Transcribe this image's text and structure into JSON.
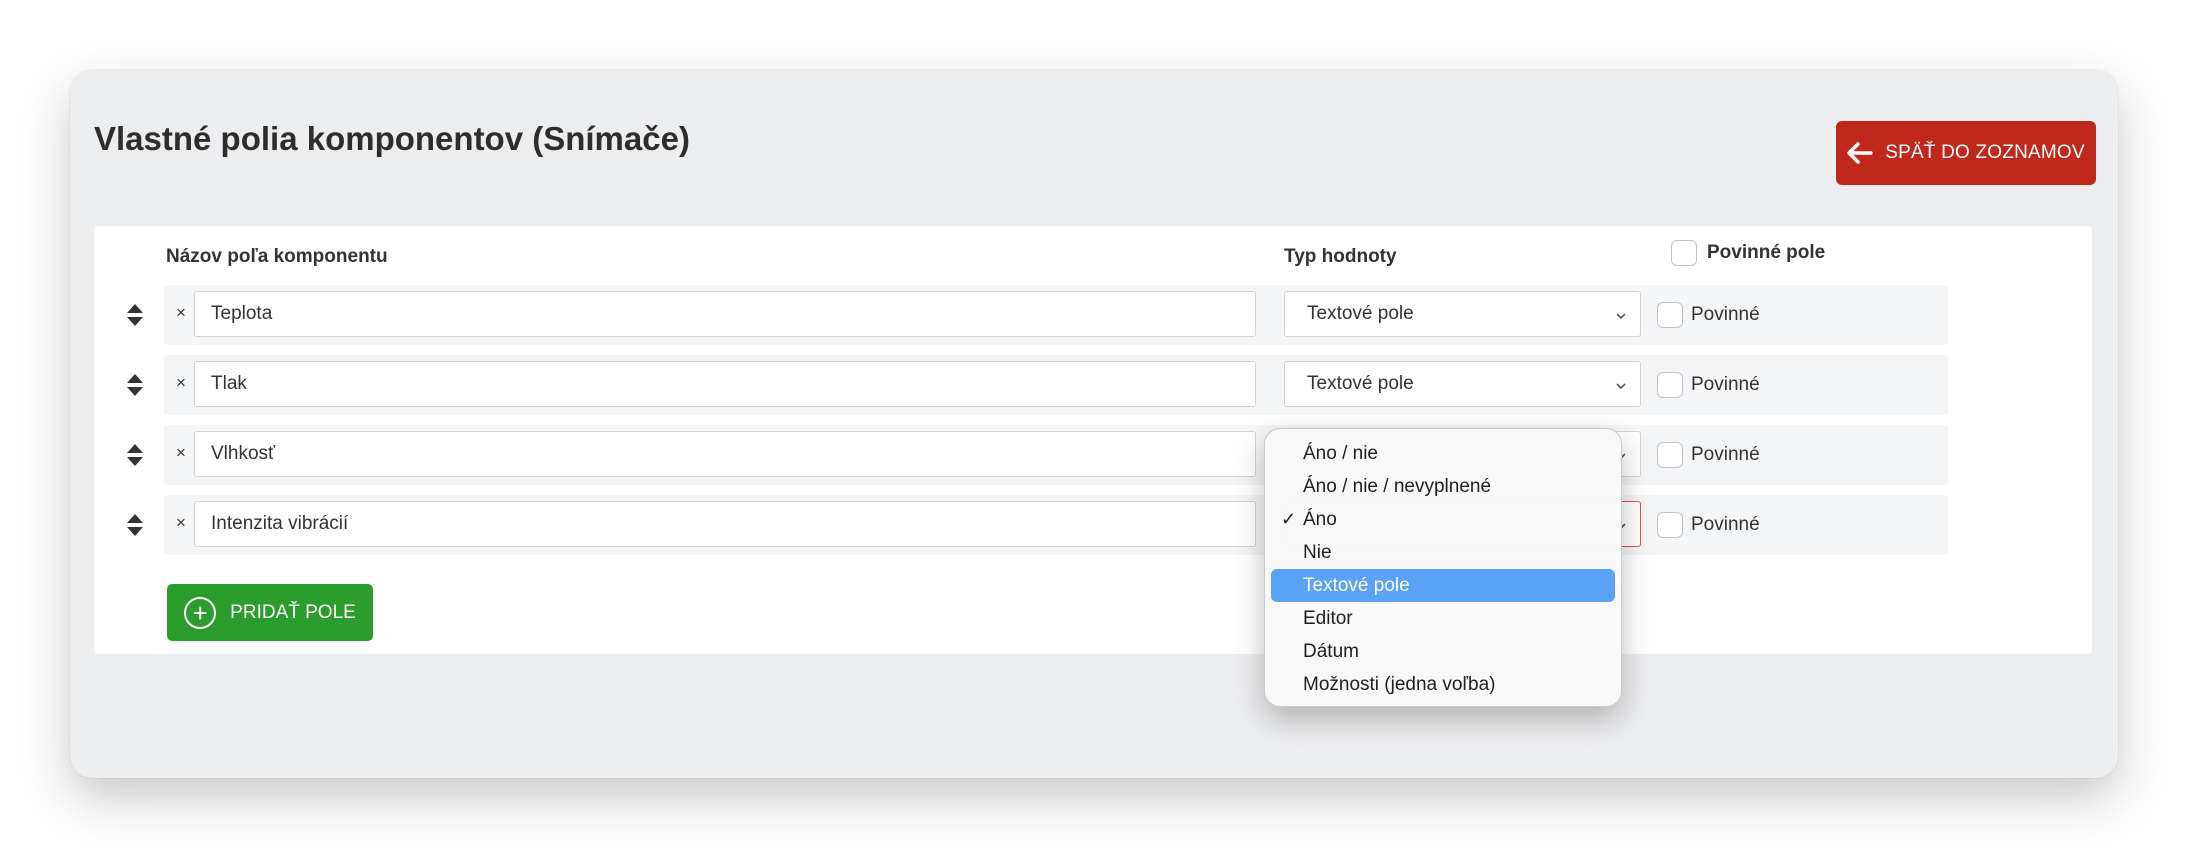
{
  "page": {
    "title": "Vlastné polia komponentov (Snímače)",
    "back_label": "SPÄŤ DO ZOZNAMOV"
  },
  "table": {
    "headers": {
      "name": "Názov poľa komponentu",
      "type": "Typ hodnoty",
      "required": "Povinné pole"
    },
    "rows": [
      {
        "name": "Teplota",
        "type": "Textové pole",
        "required_label": "Povinné",
        "required": false
      },
      {
        "name": "Tlak",
        "type": "Textové pole",
        "required_label": "Povinné",
        "required": false
      },
      {
        "name": "Vlhkosť",
        "type": "",
        "required_label": "Povinné",
        "required": false
      },
      {
        "name": "Intenzita vibrácií",
        "type": "",
        "required_label": "Povinné",
        "required": false
      }
    ],
    "remove_symbol": "×"
  },
  "add_label": "PRIDAŤ POLE",
  "dropdown": {
    "check_mark": "✓",
    "checked_index": 2,
    "highlighted_index": 4,
    "options": [
      "Áno / nie",
      "Áno / nie / nevyplnené",
      "Áno",
      "Nie",
      "Textové pole",
      "Editor",
      "Dátum",
      "Možnosti (jedna voľba)"
    ]
  },
  "colors": {
    "back_button": "#c0281e",
    "add_button": "#2a9d2d",
    "highlight": "#5aa2f5",
    "error_border": "#d9534f"
  },
  "icons": {
    "back": "arrow-left-icon",
    "add": "plus-circle-icon",
    "sort": "sort-handle-icon",
    "select": "chevron-down-icon"
  }
}
